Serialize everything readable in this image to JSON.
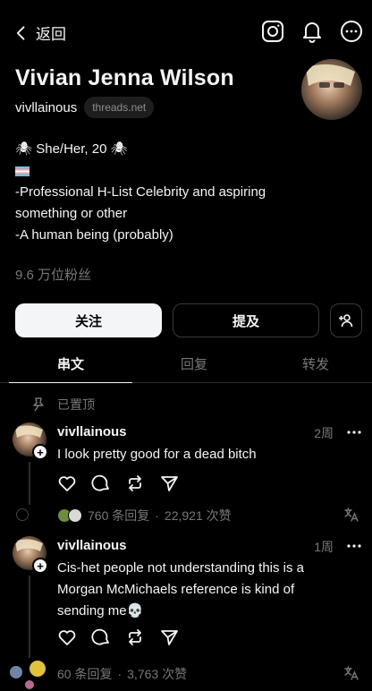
{
  "topbar": {
    "back_label": "返回"
  },
  "profile": {
    "name": "Vivian Jenna Wilson",
    "handle": "vivllainous",
    "domain": "threads.net",
    "bio": {
      "line1_emoji": "🕷",
      "line1_text": "She/Her, 20",
      "line3": "-Professional H-List Celebrity and aspiring",
      "line4": "something or other",
      "line5": "-A human being (probably)"
    },
    "followers": "9.6 万位粉丝"
  },
  "buttons": {
    "follow": "关注",
    "mention": "提及"
  },
  "tabs": [
    {
      "label": "串文"
    },
    {
      "label": "回复"
    },
    {
      "label": "转发"
    }
  ],
  "pinned_label": "已置顶",
  "posts": [
    {
      "username": "vivllainous",
      "time": "2周",
      "text_lines": [
        "I look pretty good for a dead bitch"
      ],
      "replies": "760 条回复",
      "separator": "·",
      "likes": "22,921 次赞"
    },
    {
      "username": "vivllainous",
      "time": "1周",
      "text_lines": [
        "Cis-het people not understanding this is a",
        "Morgan McMichaels reference is kind of",
        "sending me💀"
      ],
      "replies": "60 条回复",
      "separator": "·",
      "likes": "3,763 次赞"
    }
  ],
  "colors": {
    "background": "#000000",
    "text": "#f3f5f7",
    "muted": "#777777",
    "border": "#3a3a3a"
  }
}
